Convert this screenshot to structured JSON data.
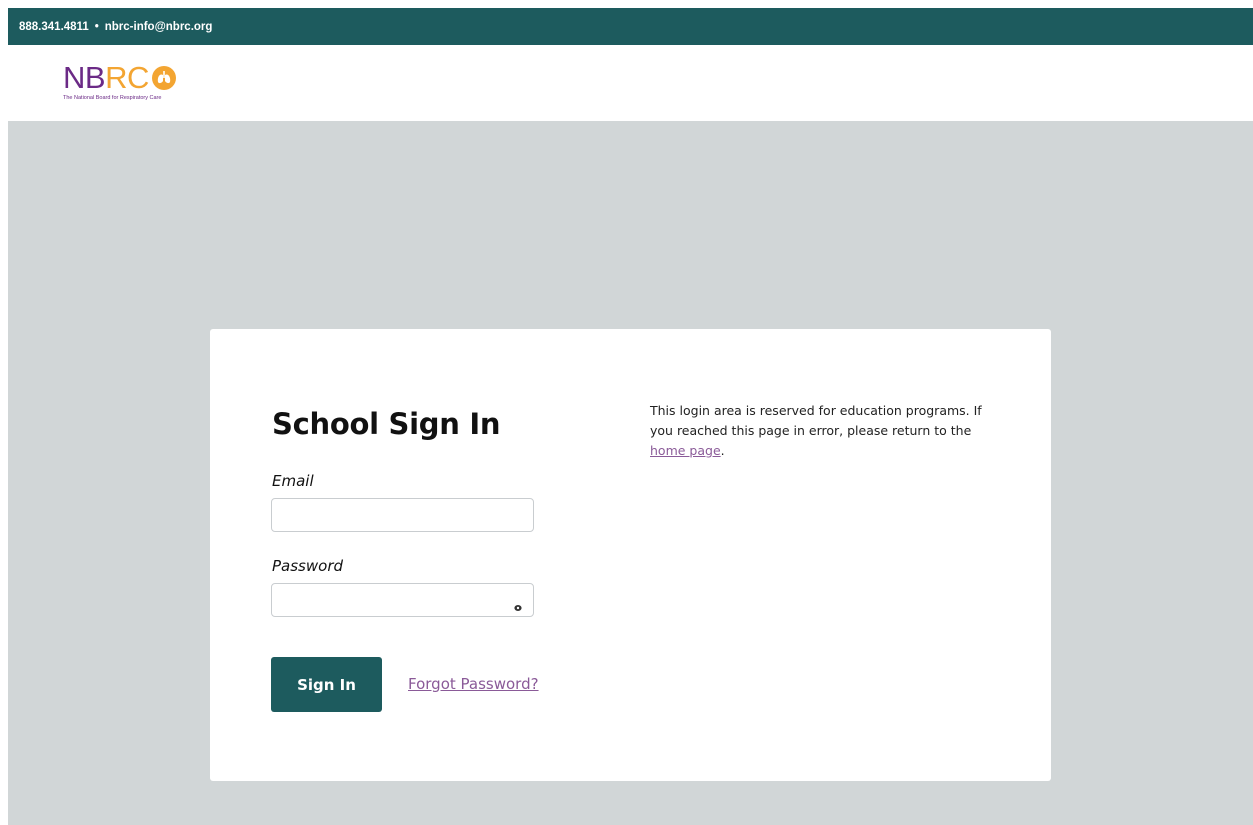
{
  "topbar": {
    "phone": "888.341.4811",
    "separator": "•",
    "email": "nbrc-info@nbrc.org",
    "background": "#1d5b5e"
  },
  "logo": {
    "letters_nb": "NB",
    "letters_rc": "RC",
    "tagline": "The National Board for Respiratory Care",
    "purple": "#6b2a86",
    "orange": "#f3a532"
  },
  "login": {
    "title": "School Sign In",
    "email_label": "Email",
    "email_value": "",
    "password_label": "Password",
    "password_value": "",
    "signin_label": "Sign In",
    "forgot_label": "Forgot Password?"
  },
  "info": {
    "text_before_link": "This login area is reserved for education programs. If you reached this page in error, please return to the ",
    "link_text": "home page",
    "text_after_link": "."
  },
  "colors": {
    "accent": "#1d5b5e",
    "link": "#8a5a98",
    "page_background": "#d1d6d7"
  },
  "icons": {
    "password_toggle": "eye-icon",
    "logo_mark": "lungs-icon"
  }
}
